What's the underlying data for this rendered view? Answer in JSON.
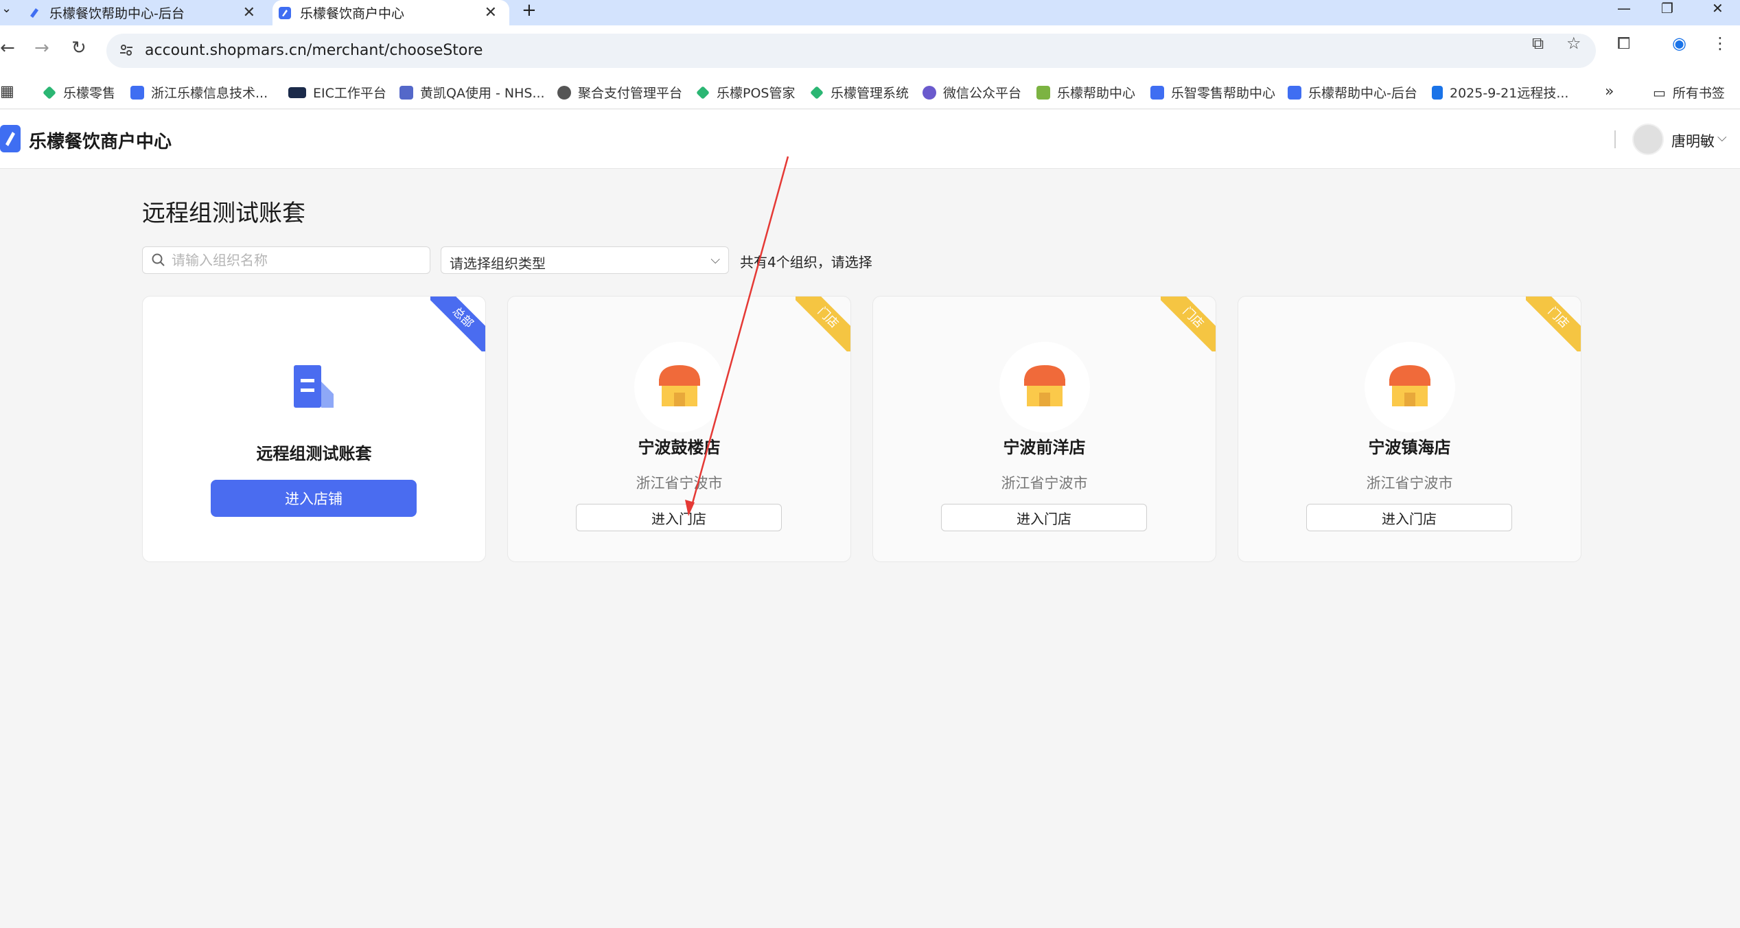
{
  "browser": {
    "tabs": [
      {
        "title": "乐檬餐饮帮助中心-后台",
        "active": false
      },
      {
        "title": "乐檬餐饮商户中心",
        "active": true
      }
    ],
    "new_tab": "+",
    "url": "account.shopmars.cn/merchant/chooseStore",
    "bookmarks": [
      {
        "label": "乐檬零售",
        "icon": "green-leaf-icon"
      },
      {
        "label": "浙江乐檬信息技术...",
        "icon": "blue-logo-icon"
      },
      {
        "label": "EIC工作平台",
        "icon": "eic-icon"
      },
      {
        "label": "黄凯QA使用 - NHS...",
        "icon": "arrows-icon"
      },
      {
        "label": "聚合支付管理平台",
        "icon": "globe-icon"
      },
      {
        "label": "乐檬POS管家",
        "icon": "green-leaf-icon"
      },
      {
        "label": "乐檬管理系统",
        "icon": "green-leaf-icon"
      },
      {
        "label": "微信公众平台",
        "icon": "link-icon"
      },
      {
        "label": "乐檬帮助中心",
        "icon": "chart-icon"
      },
      {
        "label": "乐智零售帮助中心",
        "icon": "blue-logo-icon"
      },
      {
        "label": "乐檬帮助中心-后台",
        "icon": "blue-logo-icon"
      },
      {
        "label": "2025-9-21远程技...",
        "icon": "doc-icon"
      }
    ],
    "bookmarks_more": "»",
    "all_bookmarks": "所有书签"
  },
  "header": {
    "app_title": "乐檬餐饮商户中心",
    "user_name": "唐明敏"
  },
  "main": {
    "title": "远程组测试账套",
    "search_placeholder": "请输入组织名称",
    "type_select": "请选择组织类型",
    "count_text": "共有4个组织，请选择",
    "cards": [
      {
        "tag": "总部",
        "name": "远程组测试账套",
        "button": "进入店铺"
      },
      {
        "tag": "门店",
        "name": "宁波鼓楼店",
        "location": "浙江省宁波市",
        "button": "进入门店"
      },
      {
        "tag": "门店",
        "name": "宁波前洋店",
        "location": "浙江省宁波市",
        "button": "进入门店"
      },
      {
        "tag": "门店",
        "name": "宁波镇海店",
        "location": "浙江省宁波市",
        "button": "进入门店"
      }
    ]
  },
  "colors": {
    "primary": "#4a6cf0",
    "store_ribbon": "#f5c542",
    "store_awning": "#f06a3a",
    "annotation_arrow": "#e53935"
  }
}
